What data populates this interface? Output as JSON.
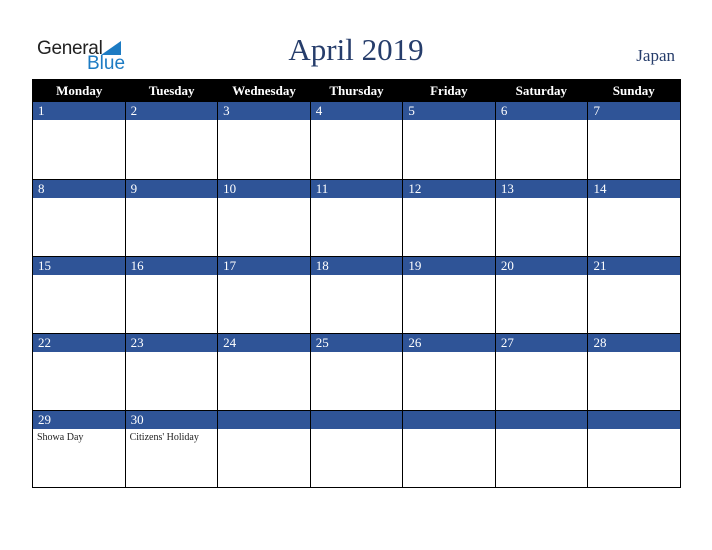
{
  "logo": {
    "line1": "General",
    "line2": "Blue"
  },
  "header": {
    "title": "April 2019",
    "country": "Japan"
  },
  "weekdays": [
    "Monday",
    "Tuesday",
    "Wednesday",
    "Thursday",
    "Friday",
    "Saturday",
    "Sunday"
  ],
  "weeks": [
    [
      {
        "day": "1",
        "event": ""
      },
      {
        "day": "2",
        "event": ""
      },
      {
        "day": "3",
        "event": ""
      },
      {
        "day": "4",
        "event": ""
      },
      {
        "day": "5",
        "event": ""
      },
      {
        "day": "6",
        "event": ""
      },
      {
        "day": "7",
        "event": ""
      }
    ],
    [
      {
        "day": "8",
        "event": ""
      },
      {
        "day": "9",
        "event": ""
      },
      {
        "day": "10",
        "event": ""
      },
      {
        "day": "11",
        "event": ""
      },
      {
        "day": "12",
        "event": ""
      },
      {
        "day": "13",
        "event": ""
      },
      {
        "day": "14",
        "event": ""
      }
    ],
    [
      {
        "day": "15",
        "event": ""
      },
      {
        "day": "16",
        "event": ""
      },
      {
        "day": "17",
        "event": ""
      },
      {
        "day": "18",
        "event": ""
      },
      {
        "day": "19",
        "event": ""
      },
      {
        "day": "20",
        "event": ""
      },
      {
        "day": "21",
        "event": ""
      }
    ],
    [
      {
        "day": "22",
        "event": ""
      },
      {
        "day": "23",
        "event": ""
      },
      {
        "day": "24",
        "event": ""
      },
      {
        "day": "25",
        "event": ""
      },
      {
        "day": "26",
        "event": ""
      },
      {
        "day": "27",
        "event": ""
      },
      {
        "day": "28",
        "event": ""
      }
    ],
    [
      {
        "day": "29",
        "event": "Showa Day"
      },
      {
        "day": "30",
        "event": "Citizens' Holiday"
      },
      {
        "day": "",
        "event": ""
      },
      {
        "day": "",
        "event": ""
      },
      {
        "day": "",
        "event": ""
      },
      {
        "day": "",
        "event": ""
      },
      {
        "day": "",
        "event": ""
      }
    ]
  ],
  "colors": {
    "band": "#2f5497",
    "header_bg": "#000000",
    "title": "#263d6b",
    "logo_blue": "#1c7bc3"
  }
}
